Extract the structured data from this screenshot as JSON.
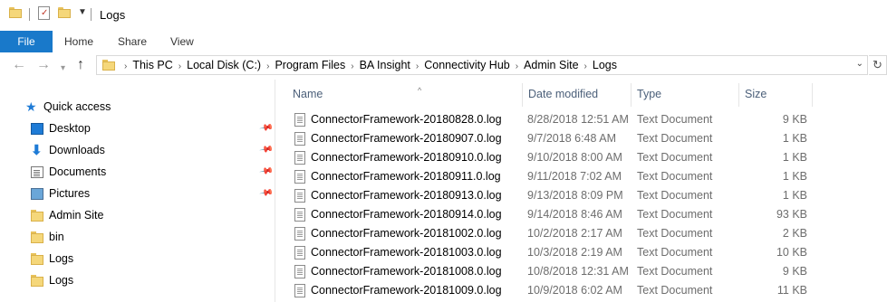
{
  "window": {
    "title": "Logs"
  },
  "ribbon": {
    "tabs": [
      "File",
      "Home",
      "Share",
      "View"
    ]
  },
  "address": {
    "crumbs": [
      "This PC",
      "Local Disk (C:)",
      "Program Files",
      "BA Insight",
      "Connectivity Hub",
      "Admin Site",
      "Logs"
    ]
  },
  "nav": {
    "quick_access": "Quick access",
    "items": [
      {
        "label": "Desktop",
        "icon": "desktop-icon",
        "pinned": true
      },
      {
        "label": "Downloads",
        "icon": "downloads-icon",
        "pinned": true
      },
      {
        "label": "Documents",
        "icon": "documents-icon",
        "pinned": true
      },
      {
        "label": "Pictures",
        "icon": "pictures-icon",
        "pinned": true
      },
      {
        "label": "Admin Site",
        "icon": "folder-icon",
        "pinned": false
      },
      {
        "label": "bin",
        "icon": "folder-icon",
        "pinned": false
      },
      {
        "label": "Logs",
        "icon": "folder-icon",
        "pinned": false
      },
      {
        "label": "Logs",
        "icon": "folder-icon",
        "pinned": false
      }
    ]
  },
  "columns": {
    "name": "Name",
    "date": "Date modified",
    "type": "Type",
    "size": "Size"
  },
  "files": [
    {
      "name": "ConnectorFramework-20180828.0.log",
      "date": "8/28/2018 12:51 AM",
      "type": "Text Document",
      "size": "9 KB"
    },
    {
      "name": "ConnectorFramework-20180907.0.log",
      "date": "9/7/2018 6:48 AM",
      "type": "Text Document",
      "size": "1 KB"
    },
    {
      "name": "ConnectorFramework-20180910.0.log",
      "date": "9/10/2018 8:00 AM",
      "type": "Text Document",
      "size": "1 KB"
    },
    {
      "name": "ConnectorFramework-20180911.0.log",
      "date": "9/11/2018 7:02 AM",
      "type": "Text Document",
      "size": "1 KB"
    },
    {
      "name": "ConnectorFramework-20180913.0.log",
      "date": "9/13/2018 8:09 PM",
      "type": "Text Document",
      "size": "1 KB"
    },
    {
      "name": "ConnectorFramework-20180914.0.log",
      "date": "9/14/2018 8:46 AM",
      "type": "Text Document",
      "size": "93 KB"
    },
    {
      "name": "ConnectorFramework-20181002.0.log",
      "date": "10/2/2018 2:17 AM",
      "type": "Text Document",
      "size": "2 KB"
    },
    {
      "name": "ConnectorFramework-20181003.0.log",
      "date": "10/3/2018 2:19 AM",
      "type": "Text Document",
      "size": "10 KB"
    },
    {
      "name": "ConnectorFramework-20181008.0.log",
      "date": "10/8/2018 12:31 AM",
      "type": "Text Document",
      "size": "9 KB"
    },
    {
      "name": "ConnectorFramework-20181009.0.log",
      "date": "10/9/2018 6:02 AM",
      "type": "Text Document",
      "size": "11 KB"
    }
  ]
}
